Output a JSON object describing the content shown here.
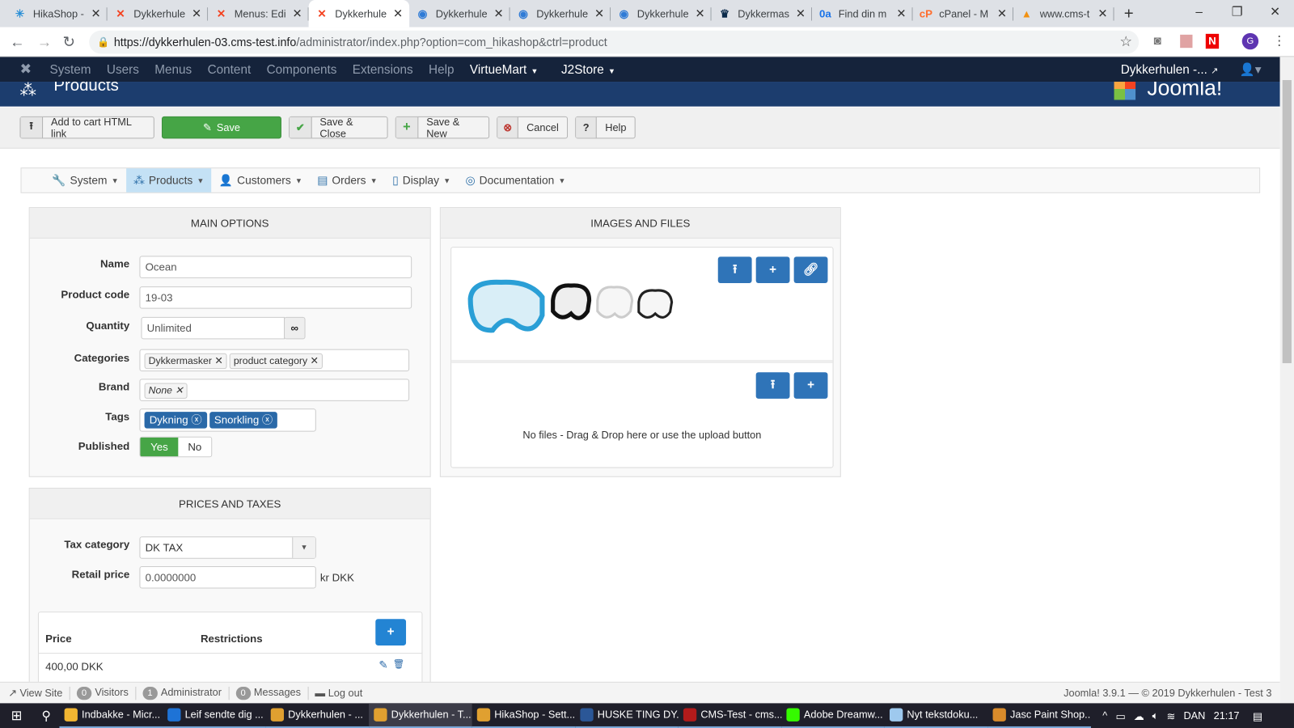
{
  "browser": {
    "tabs": [
      {
        "title": "HikaShop -",
        "icon": "hikashop-icon",
        "color": "#2a8fd6",
        "glyph": "✳"
      },
      {
        "title": "Dykkerhule",
        "icon": "joomla-icon",
        "color": "#f44321",
        "glyph": "✕"
      },
      {
        "title": "Menus: Edi",
        "icon": "joomla-icon",
        "color": "#f44321",
        "glyph": "✕"
      },
      {
        "title": "Dykkerhule",
        "icon": "joomla-icon",
        "color": "#f44321",
        "glyph": "✕"
      },
      {
        "title": "Dykkerhule",
        "icon": "fish-icon",
        "color": "#2f7bd6",
        "glyph": "◉"
      },
      {
        "title": "Dykkerhule",
        "icon": "fish-icon",
        "color": "#2f7bd6",
        "glyph": "◉"
      },
      {
        "title": "Dykkerhule",
        "icon": "fish-icon",
        "color": "#2f7bd6",
        "glyph": "◉"
      },
      {
        "title": "Dykkermas",
        "icon": "crown-icon",
        "color": "#0b2a4a",
        "glyph": "♛"
      },
      {
        "title": "Find din m",
        "icon": "oa-icon",
        "color": "#1a73e8",
        "glyph": "0a"
      },
      {
        "title": "cPanel - M",
        "icon": "cpanel-icon",
        "color": "#ff6c2c",
        "glyph": "cP"
      },
      {
        "title": "www.cms-t",
        "icon": "phpmyadmin-icon",
        "color": "#f29111",
        "glyph": "▲"
      }
    ],
    "active_tab": 3,
    "url_host": "https://dykkerhulen-03.cms-test.info",
    "url_path": "/administrator/index.php?option=com_hikashop&ctrl=product",
    "profile_initial": "G"
  },
  "joomla": {
    "menu": [
      "System",
      "Users",
      "Menus",
      "Content",
      "Components",
      "Extensions",
      "Help"
    ],
    "menu_extra": [
      "VirtueMart",
      "J2Store"
    ],
    "site_name": "Dykkerhulen -...",
    "page_title": "Products",
    "logo_text": "Joomla!"
  },
  "toolbar": {
    "add_to_cart": "Add to cart HTML link",
    "save": "Save",
    "save_close": "Save & Close",
    "save_new": "Save & New",
    "cancel": "Cancel",
    "help": "Help"
  },
  "submenu": [
    {
      "label": "System",
      "icon": "wrench-icon",
      "glyph": "🔧"
    },
    {
      "label": "Products",
      "icon": "cubes-icon",
      "glyph": "⁂"
    },
    {
      "label": "Customers",
      "icon": "user-icon",
      "glyph": "👤"
    },
    {
      "label": "Orders",
      "icon": "credit-card-icon",
      "glyph": "▤"
    },
    {
      "label": "Display",
      "icon": "mobile-icon",
      "glyph": "▯"
    },
    {
      "label": "Documentation",
      "icon": "life-ring-icon",
      "glyph": "◎"
    }
  ],
  "main_options": {
    "title": "MAIN OPTIONS",
    "name_label": "Name",
    "name": "Ocean",
    "code_label": "Product code",
    "code": "19-03",
    "quantity_label": "Quantity",
    "quantity": "Unlimited",
    "categories_label": "Categories",
    "categories": [
      "Dykkermasker",
      "product category"
    ],
    "brand_label": "Brand",
    "brand": "None",
    "tags_label": "Tags",
    "tags": [
      "Dykning",
      "Snorkling"
    ],
    "published_label": "Published",
    "yes": "Yes",
    "no": "No",
    "published": true
  },
  "images": {
    "title": "IMAGES AND FILES",
    "no_files": "No files - Drag & Drop here or use the upload button"
  },
  "prices": {
    "title": "PRICES AND TAXES",
    "tax_label": "Tax category",
    "tax": "DK TAX",
    "retail_label": "Retail price",
    "retail": "0.0000000",
    "currency": "kr DKK",
    "col_price": "Price",
    "col_restrictions": "Restrictions",
    "rows": [
      {
        "price": "400,00 DKK"
      }
    ]
  },
  "status": {
    "view_site": "View Site",
    "visitors_count": "0",
    "visitors": "Visitors",
    "admin_count": "1",
    "admin": "Administrator",
    "messages_count": "0",
    "messages": "Messages",
    "logout": "Log out",
    "version": "Joomla! 3.9.1 — © 2019 Dykkerhulen - Test 3"
  },
  "taskbar": {
    "items": [
      {
        "label": "Indbakke - Micr...",
        "color": "#f2b632"
      },
      {
        "label": "Leif sendte dig ...",
        "color": "#1e73d6"
      },
      {
        "label": "Dykkerhulen - ...",
        "color": "#e0a030"
      },
      {
        "label": "Dykkerhulen - T...",
        "color": "#e0a030"
      },
      {
        "label": "HikaShop - Sett...",
        "color": "#e0a030"
      },
      {
        "label": "HUSKE TING DY...",
        "color": "#2b5797"
      },
      {
        "label": "CMS-Test - cms...",
        "color": "#b31b1b"
      },
      {
        "label": "Adobe Dreamw...",
        "color": "#35fa00"
      },
      {
        "label": "Nyt tekstdoku...",
        "color": "#9ec9ee"
      },
      {
        "label": "Jasc Paint Shop...",
        "color": "#d98b2b"
      }
    ],
    "active": 3,
    "lang": "DAN",
    "time": "21:17"
  }
}
